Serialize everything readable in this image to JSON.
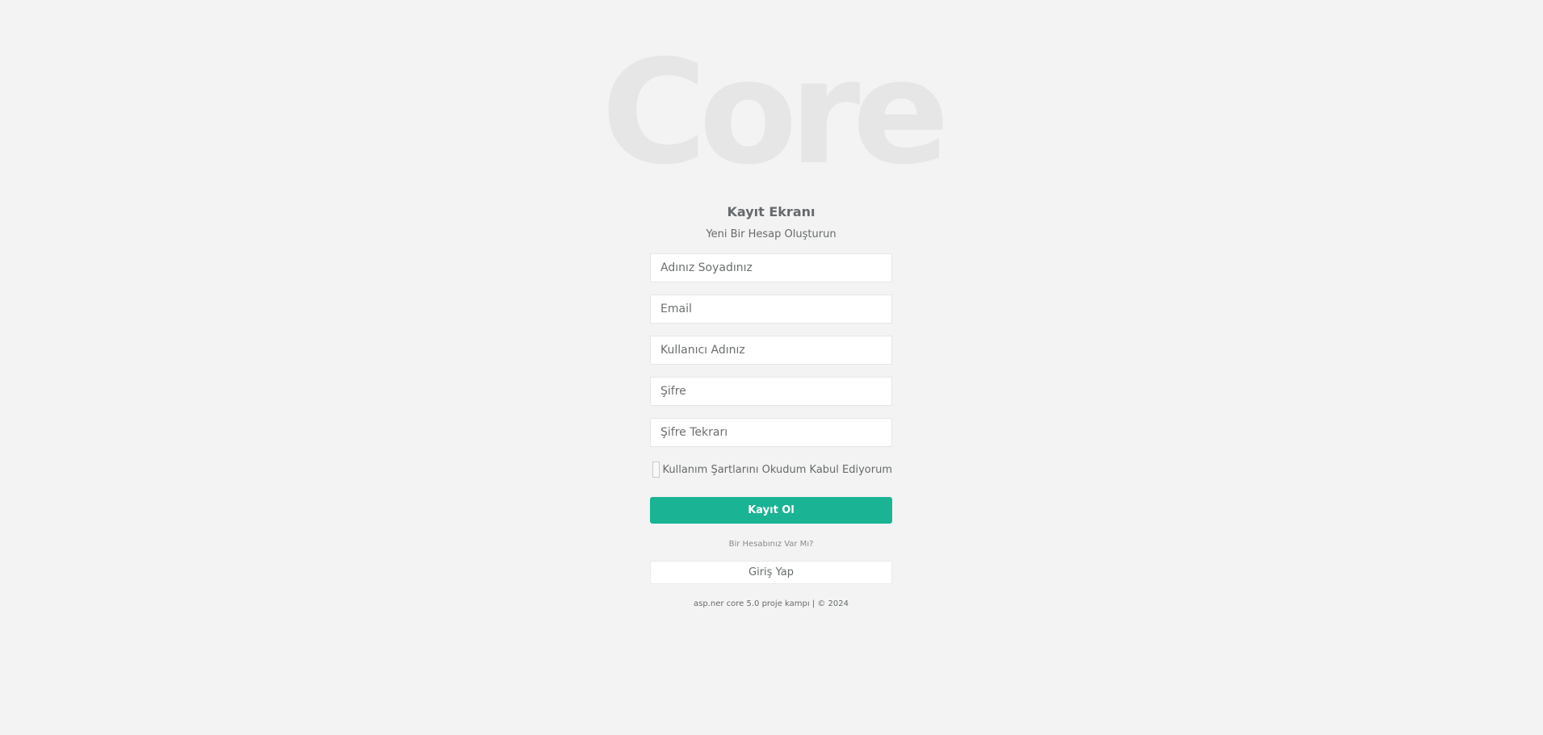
{
  "logo": {
    "text": "Core"
  },
  "form": {
    "title": "Kayıt Ekranı",
    "subtitle": "Yeni Bir Hesap Oluşturun",
    "fields": {
      "fullname": {
        "placeholder": "Adınız Soyadınız",
        "value": ""
      },
      "email": {
        "placeholder": "Email",
        "value": ""
      },
      "username": {
        "placeholder": "Kullanıcı Adınız",
        "value": ""
      },
      "password": {
        "placeholder": "Şifre",
        "value": ""
      },
      "password_repeat": {
        "placeholder": "Şifre Tekrarı",
        "value": ""
      }
    },
    "terms": {
      "label": "Kullanım Şartlarını Okudum Kabul Ediyorum",
      "checked": false
    },
    "register_label": "Kayıt Ol",
    "have_account_text": "Bir Hesabınız Var Mı?",
    "login_label": "Giriş Yap"
  },
  "footer": {
    "text": "asp.ner core 5.0 proje kampı | © 2024"
  },
  "colors": {
    "background": "#f3f3f3",
    "accent": "#1ab394",
    "logo": "#e6e6e6"
  }
}
